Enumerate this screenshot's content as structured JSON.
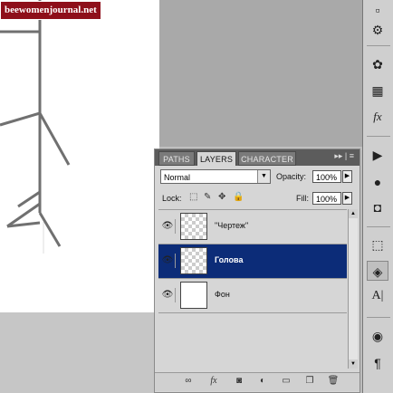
{
  "watermark": "beewomenjournal.net",
  "panel": {
    "tabs": [
      {
        "label": "PATHS",
        "active": false
      },
      {
        "label": "LAYERS",
        "active": true
      },
      {
        "label": "CHARACTER",
        "active": false
      }
    ],
    "tab_menu_glyph": "▸▸ | ≡",
    "blend_mode": "Normal",
    "opacity_label": "Opacity:",
    "opacity_value": "100%",
    "lock_label": "Lock:",
    "fill_label": "Fill:",
    "fill_value": "100%",
    "layers": [
      {
        "name": "\"Чертеж\"",
        "thumb": "transparent",
        "selected": false
      },
      {
        "name": "Голова",
        "thumb": "transparent",
        "selected": true
      },
      {
        "name": "Фон",
        "thumb": "white",
        "selected": false
      }
    ],
    "bottom_icons": [
      "link-icon",
      "fx-icon",
      "mask-icon",
      "adjustment-icon",
      "group-icon",
      "new-layer-icon",
      "trash-icon"
    ]
  },
  "toolbar_icons": [
    "history-icon",
    "clone-source-icon",
    "brush-presets-icon",
    "grid-icon",
    "effects-icon",
    "play-icon",
    "circle-icon",
    "square-mask-icon",
    "transform-icon",
    "layers-stack-icon",
    "type-icon",
    "blob-icon",
    "paragraph-icon"
  ],
  "colors": {
    "selected_layer": "#0c2c78",
    "watermark_bg": "#8e0f1a"
  }
}
